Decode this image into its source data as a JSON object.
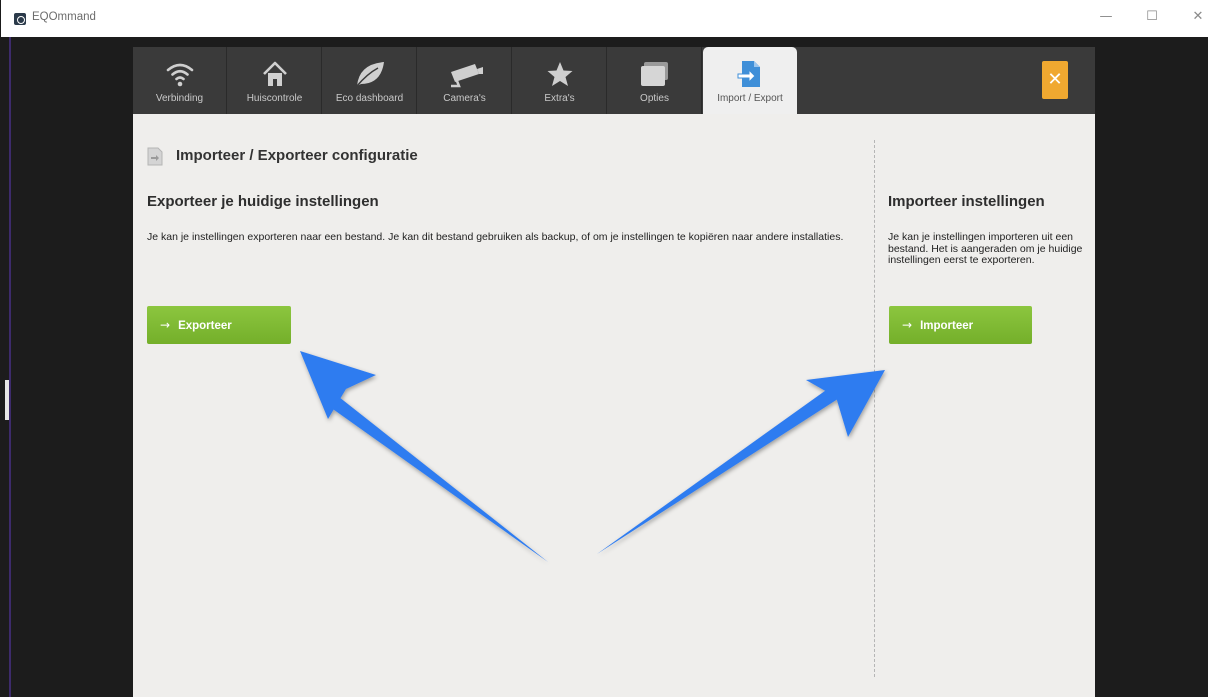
{
  "window": {
    "title": "EQOmmand",
    "minimize_glyph": "—",
    "maximize_glyph": "☐",
    "close_glyph": "✕"
  },
  "nav": {
    "tabs": [
      {
        "label": "Verbinding",
        "icon": "wifi-icon",
        "active": false
      },
      {
        "label": "Huiscontrole",
        "icon": "house-icon",
        "active": false
      },
      {
        "label": "Eco dashboard",
        "icon": "leaf-icon",
        "active": false
      },
      {
        "label": "Camera's",
        "icon": "camera-icon",
        "active": false
      },
      {
        "label": "Extra's",
        "icon": "star-icon",
        "active": false
      },
      {
        "label": "Opties",
        "icon": "layers-icon",
        "active": false
      },
      {
        "label": "Import / Export",
        "icon": "import-export-icon",
        "active": true
      }
    ],
    "close_glyph": "✕"
  },
  "page": {
    "title": "Importeer / Exporteer configuratie"
  },
  "export": {
    "title": "Exporteer je huidige instellingen",
    "text": "Je kan je instellingen exporteren naar een bestand. Je kan dit bestand gebruiken als backup, of om je instellingen te kopiëren naar andere installaties.",
    "button_label": "Exporteer",
    "button_arrow": "→"
  },
  "import": {
    "title": "Importeer instellingen",
    "text": "Je kan je instellingen importeren uit een bestand. Het is aangeraden om je huidige instellingen eerst te exporteren.",
    "button_label": "Importeer",
    "button_arrow": "→"
  },
  "colors": {
    "accent_green": "#7cb82f",
    "close_orange": "#f0a830",
    "annotation_blue": "#2f7cf0",
    "nav_bg": "#3a3a3a",
    "content_bg": "#efeeec"
  }
}
